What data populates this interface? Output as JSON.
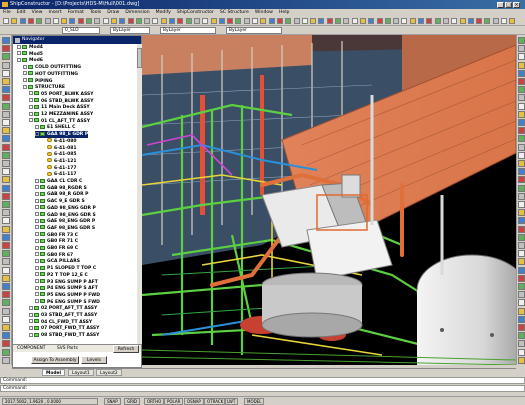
{
  "window": {
    "title": "ShipConstructor - [D:\\Projects\\HDS-M\\Hull\\001.dwg]"
  },
  "menu": [
    "File",
    "Edit",
    "View",
    "Insert",
    "Format",
    "Tools",
    "Draw",
    "Dimension",
    "Modify",
    "ShipConstructor",
    "SC Structure",
    "Window",
    "Help"
  ],
  "toolbar": {
    "layer_combo": "0_SLO",
    "linetype_combo": "ByLayer",
    "lineweight_combo": "ByLayer",
    "color_combo": "ByLayer"
  },
  "panel": {
    "title": "Navigator",
    "tree": [
      {
        "label": "Mod4",
        "indent": 3,
        "type": "folder"
      },
      {
        "label": "Mod5",
        "indent": 3,
        "type": "folder"
      },
      {
        "label": "Mod6",
        "indent": 3,
        "type": "folder"
      },
      {
        "label": "COLD OUTFITTING",
        "indent": 4,
        "type": "folder"
      },
      {
        "label": "HOT OUTFITTING",
        "indent": 4,
        "type": "folder"
      },
      {
        "label": "PIPING",
        "indent": 4,
        "type": "folder"
      },
      {
        "label": "STRUCTURE",
        "indent": 4,
        "type": "folder"
      },
      {
        "label": "05 PORT_BLWK ASSY",
        "indent": 5,
        "type": "folder"
      },
      {
        "label": "06 STBD_BLWK ASSY",
        "indent": 5,
        "type": "folder"
      },
      {
        "label": "11 Main Deck ASSY",
        "indent": 5,
        "type": "folder"
      },
      {
        "label": "12 MEZZANINE ASSY",
        "indent": 5,
        "type": "folder"
      },
      {
        "label": "01 CL_AFT_TT ASSY",
        "indent": 5,
        "type": "folder"
      },
      {
        "label": "E1 SHELL C",
        "indent": 6,
        "type": "folder"
      },
      {
        "label": "GAA 98_E GDR P",
        "indent": 6,
        "type": "folder",
        "selected": true
      },
      {
        "label": "6-41-080",
        "indent": 8,
        "type": "part"
      },
      {
        "label": "6-41-081",
        "indent": 8,
        "type": "part"
      },
      {
        "label": "6-41-085",
        "indent": 8,
        "type": "part"
      },
      {
        "label": "6-41-121",
        "indent": 8,
        "type": "part"
      },
      {
        "label": "6-41-177",
        "indent": 8,
        "type": "part"
      },
      {
        "label": "6-41-117",
        "indent": 8,
        "type": "part"
      },
      {
        "label": "GAA CL CDR C",
        "indent": 6,
        "type": "folder"
      },
      {
        "label": "GAB 98_RGDR S",
        "indent": 6,
        "type": "folder"
      },
      {
        "label": "GAB 98_R GDR P",
        "indent": 6,
        "type": "folder"
      },
      {
        "label": "GAC 9_E GDR S",
        "indent": 6,
        "type": "folder"
      },
      {
        "label": "GAD 98_ENG GDR P",
        "indent": 6,
        "type": "folder"
      },
      {
        "label": "GAD 98_ENG GDR S",
        "indent": 6,
        "type": "folder"
      },
      {
        "label": "GAE 98_ENG GDR P",
        "indent": 6,
        "type": "folder"
      },
      {
        "label": "GAF 98_ENG GDR S",
        "indent": 6,
        "type": "folder"
      },
      {
        "label": "GB0 FR 73 C",
        "indent": 6,
        "type": "folder"
      },
      {
        "label": "GB0 FR 71 C",
        "indent": 6,
        "type": "folder"
      },
      {
        "label": "GB0 FR 69 C",
        "indent": 6,
        "type": "folder"
      },
      {
        "label": "GB0 FR 67",
        "indent": 6,
        "type": "folder"
      },
      {
        "label": "GCA PILLARS",
        "indent": 6,
        "type": "folder"
      },
      {
        "label": "P1 SLOPED T TOP C",
        "indent": 6,
        "type": "folder"
      },
      {
        "label": "P2 T TOP 12_E C",
        "indent": 6,
        "type": "folder"
      },
      {
        "label": "P3 ENG SUMP P AFT",
        "indent": 6,
        "type": "folder"
      },
      {
        "label": "P4 ENG SUMP S AFT",
        "indent": 6,
        "type": "folder"
      },
      {
        "label": "P5 ENG SUMP P FWD",
        "indent": 6,
        "type": "folder"
      },
      {
        "label": "P6 ENG SUMP S FWD",
        "indent": 6,
        "type": "folder"
      },
      {
        "label": "02 PORT_AFT_TT ASSY",
        "indent": 5,
        "type": "folder"
      },
      {
        "label": "03 STBD_AFT_TT ASSY",
        "indent": 5,
        "type": "folder"
      },
      {
        "label": "04 CL_FWD_TT ASSY",
        "indent": 5,
        "type": "folder"
      },
      {
        "label": "07 PORT_FWD_TT ASSY",
        "indent": 5,
        "type": "folder"
      },
      {
        "label": "08 STBD_FWD_TT ASSY",
        "indent": 5,
        "type": "folder"
      }
    ],
    "tabs": [
      "COMPONENT",
      "SVS Parts"
    ],
    "refresh_label": "Refresh",
    "assign_label": "Assign To Assembly",
    "levels_label": "Levels"
  },
  "layout_tabs": [
    "Model",
    "Layout1",
    "Layout2"
  ],
  "command": {
    "line1": "Command:",
    "line2": "Command:"
  },
  "status": {
    "coords": "2017.5002, 1.9620 , 0.0000",
    "toggles": [
      "SNAP",
      "GRID",
      "ORTHO",
      "POLAR",
      "OSNAP",
      "OTRACK",
      "LWT",
      "MODEL"
    ]
  },
  "colors": {
    "accent": "#0a246a",
    "pipe_green": "#5cd040",
    "pipe_orange": "#e0703a",
    "deck": "#e98a5a",
    "equipment": "#e8e8e8",
    "hull": "#c8d4e4"
  }
}
